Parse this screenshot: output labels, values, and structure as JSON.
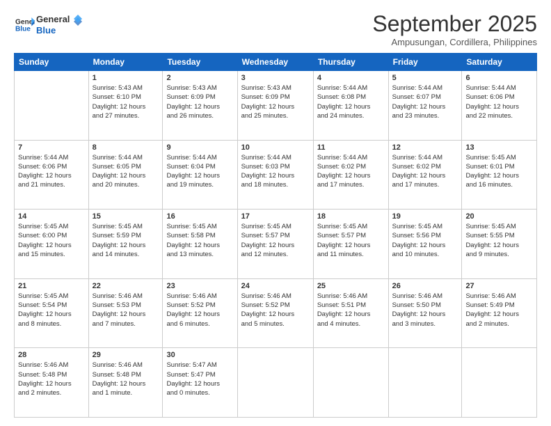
{
  "logo": {
    "line1": "General",
    "line2": "Blue"
  },
  "title": "September 2025",
  "location": "Ampusungan, Cordillera, Philippines",
  "headers": [
    "Sunday",
    "Monday",
    "Tuesday",
    "Wednesday",
    "Thursday",
    "Friday",
    "Saturday"
  ],
  "weeks": [
    [
      {
        "day": "",
        "info": ""
      },
      {
        "day": "1",
        "info": "Sunrise: 5:43 AM\nSunset: 6:10 PM\nDaylight: 12 hours\nand 27 minutes."
      },
      {
        "day": "2",
        "info": "Sunrise: 5:43 AM\nSunset: 6:09 PM\nDaylight: 12 hours\nand 26 minutes."
      },
      {
        "day": "3",
        "info": "Sunrise: 5:43 AM\nSunset: 6:09 PM\nDaylight: 12 hours\nand 25 minutes."
      },
      {
        "day": "4",
        "info": "Sunrise: 5:44 AM\nSunset: 6:08 PM\nDaylight: 12 hours\nand 24 minutes."
      },
      {
        "day": "5",
        "info": "Sunrise: 5:44 AM\nSunset: 6:07 PM\nDaylight: 12 hours\nand 23 minutes."
      },
      {
        "day": "6",
        "info": "Sunrise: 5:44 AM\nSunset: 6:06 PM\nDaylight: 12 hours\nand 22 minutes."
      }
    ],
    [
      {
        "day": "7",
        "info": "Sunrise: 5:44 AM\nSunset: 6:06 PM\nDaylight: 12 hours\nand 21 minutes."
      },
      {
        "day": "8",
        "info": "Sunrise: 5:44 AM\nSunset: 6:05 PM\nDaylight: 12 hours\nand 20 minutes."
      },
      {
        "day": "9",
        "info": "Sunrise: 5:44 AM\nSunset: 6:04 PM\nDaylight: 12 hours\nand 19 minutes."
      },
      {
        "day": "10",
        "info": "Sunrise: 5:44 AM\nSunset: 6:03 PM\nDaylight: 12 hours\nand 18 minutes."
      },
      {
        "day": "11",
        "info": "Sunrise: 5:44 AM\nSunset: 6:02 PM\nDaylight: 12 hours\nand 17 minutes."
      },
      {
        "day": "12",
        "info": "Sunrise: 5:44 AM\nSunset: 6:02 PM\nDaylight: 12 hours\nand 17 minutes."
      },
      {
        "day": "13",
        "info": "Sunrise: 5:45 AM\nSunset: 6:01 PM\nDaylight: 12 hours\nand 16 minutes."
      }
    ],
    [
      {
        "day": "14",
        "info": "Sunrise: 5:45 AM\nSunset: 6:00 PM\nDaylight: 12 hours\nand 15 minutes."
      },
      {
        "day": "15",
        "info": "Sunrise: 5:45 AM\nSunset: 5:59 PM\nDaylight: 12 hours\nand 14 minutes."
      },
      {
        "day": "16",
        "info": "Sunrise: 5:45 AM\nSunset: 5:58 PM\nDaylight: 12 hours\nand 13 minutes."
      },
      {
        "day": "17",
        "info": "Sunrise: 5:45 AM\nSunset: 5:57 PM\nDaylight: 12 hours\nand 12 minutes."
      },
      {
        "day": "18",
        "info": "Sunrise: 5:45 AM\nSunset: 5:57 PM\nDaylight: 12 hours\nand 11 minutes."
      },
      {
        "day": "19",
        "info": "Sunrise: 5:45 AM\nSunset: 5:56 PM\nDaylight: 12 hours\nand 10 minutes."
      },
      {
        "day": "20",
        "info": "Sunrise: 5:45 AM\nSunset: 5:55 PM\nDaylight: 12 hours\nand 9 minutes."
      }
    ],
    [
      {
        "day": "21",
        "info": "Sunrise: 5:45 AM\nSunset: 5:54 PM\nDaylight: 12 hours\nand 8 minutes."
      },
      {
        "day": "22",
        "info": "Sunrise: 5:46 AM\nSunset: 5:53 PM\nDaylight: 12 hours\nand 7 minutes."
      },
      {
        "day": "23",
        "info": "Sunrise: 5:46 AM\nSunset: 5:52 PM\nDaylight: 12 hours\nand 6 minutes."
      },
      {
        "day": "24",
        "info": "Sunrise: 5:46 AM\nSunset: 5:52 PM\nDaylight: 12 hours\nand 5 minutes."
      },
      {
        "day": "25",
        "info": "Sunrise: 5:46 AM\nSunset: 5:51 PM\nDaylight: 12 hours\nand 4 minutes."
      },
      {
        "day": "26",
        "info": "Sunrise: 5:46 AM\nSunset: 5:50 PM\nDaylight: 12 hours\nand 3 minutes."
      },
      {
        "day": "27",
        "info": "Sunrise: 5:46 AM\nSunset: 5:49 PM\nDaylight: 12 hours\nand 2 minutes."
      }
    ],
    [
      {
        "day": "28",
        "info": "Sunrise: 5:46 AM\nSunset: 5:48 PM\nDaylight: 12 hours\nand 2 minutes."
      },
      {
        "day": "29",
        "info": "Sunrise: 5:46 AM\nSunset: 5:48 PM\nDaylight: 12 hours\nand 1 minute."
      },
      {
        "day": "30",
        "info": "Sunrise: 5:47 AM\nSunset: 5:47 PM\nDaylight: 12 hours\nand 0 minutes."
      },
      {
        "day": "",
        "info": ""
      },
      {
        "day": "",
        "info": ""
      },
      {
        "day": "",
        "info": ""
      },
      {
        "day": "",
        "info": ""
      }
    ]
  ]
}
